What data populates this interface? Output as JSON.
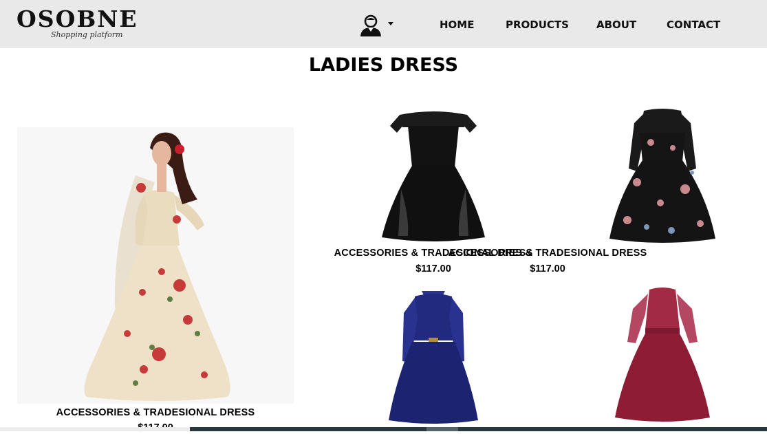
{
  "brand": {
    "name": "OSOBNE",
    "tagline": "Shopping platform"
  },
  "nav": {
    "user_icon": "user-avatar-icon",
    "items": [
      {
        "label": "HOME"
      },
      {
        "label": "PRODUCTS"
      },
      {
        "label": "ABOUT"
      },
      {
        "label": "CONTACT"
      }
    ]
  },
  "page": {
    "title": "LADIES DRESS"
  },
  "products": [
    {
      "name": "ACCESSORIES & TRADESIONAL DRESS",
      "price": "$117.00",
      "image": "cream-floral-gown",
      "color": "#eee1c8"
    },
    {
      "name": "ACCESSORIES & TRADESIONAL DRESS",
      "price": "$117.00",
      "image": "black-lace-dress",
      "color": "#121212"
    },
    {
      "name": "ACCESSORIES & TRADESIONAL DRESS",
      "price": "$117.00",
      "image": "black-floral-dress",
      "color": "#141414"
    },
    {
      "name": "",
      "price": "",
      "image": "navy-lace-dress",
      "color": "#1c2370"
    },
    {
      "name": "",
      "price": "",
      "image": "burgundy-lace-dress",
      "color": "#8f1c35"
    }
  ]
}
